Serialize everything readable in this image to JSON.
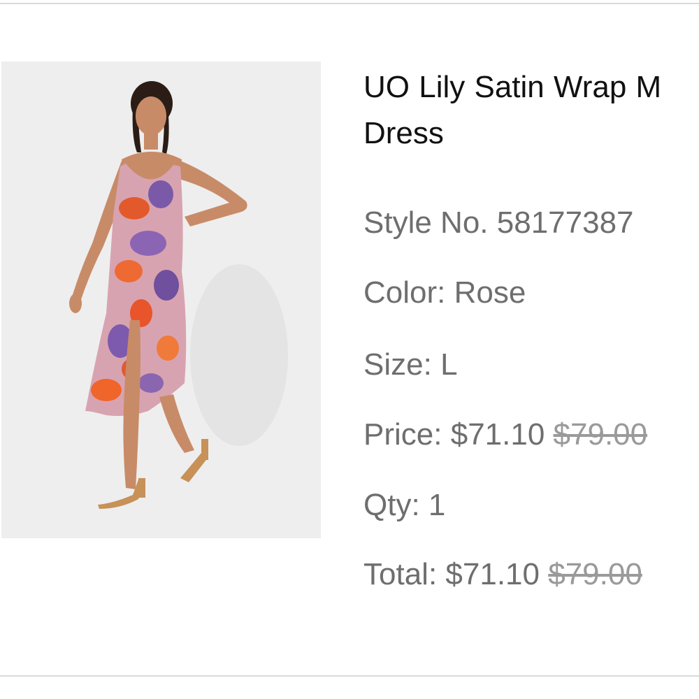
{
  "product": {
    "image_alt": "Model wearing floral print satin wrap midi dress",
    "title": "UO Lily Satin Wrap M Dress",
    "title_line1": "UO Lily Satin Wrap M",
    "title_line2": "Dress",
    "style_label": "Style No.",
    "style_no": "58177387",
    "color_label": "Color:",
    "color": "Rose",
    "size_label": "Size:",
    "size": "L",
    "price_label": "Price:",
    "price": "$71.10",
    "price_original": "$79.00",
    "qty_label": "Qty:",
    "qty": "1",
    "total_label": "Total:",
    "total": "$71.10",
    "total_original": "$79.00"
  },
  "colors": {
    "title_text": "#111111",
    "detail_text": "#6e6e6e",
    "strike_text": "#9a9a9a",
    "divider": "#d9d9d9",
    "image_bg": "#ededed"
  }
}
